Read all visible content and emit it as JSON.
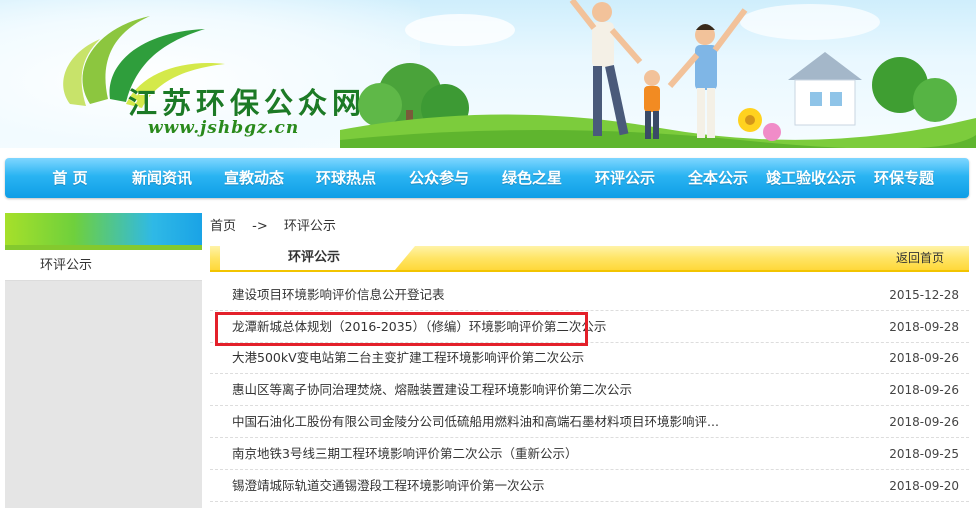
{
  "header": {
    "site_name": "江苏环保公众网",
    "site_url": "www.jshbgz.cn"
  },
  "nav": {
    "items": [
      "首 页",
      "新闻资讯",
      "宣教动态",
      "环球热点",
      "公众参与",
      "绿色之星",
      "环评公示",
      "全本公示",
      "竣工验收公示",
      "环保专题"
    ]
  },
  "sidebar": {
    "items": [
      "环评公示"
    ]
  },
  "breadcrumb": {
    "home": "首页",
    "separator": "->",
    "current": "环评公示"
  },
  "section": {
    "title": "环评公示",
    "back_label": "返回首页"
  },
  "articles": [
    {
      "title": "建设项目环境影响评价信息公开登记表",
      "date": "2015-12-28"
    },
    {
      "title": "龙潭新城总体规划（2016-2035）（修编）环境影响评价第二次公示",
      "date": "2018-09-28"
    },
    {
      "title": "大港500kV变电站第二台主变扩建工程环境影响评价第二次公示",
      "date": "2018-09-26"
    },
    {
      "title": "惠山区等离子协同治理焚烧、熔融装置建设工程环境影响评价第二次公示",
      "date": "2018-09-26"
    },
    {
      "title": "中国石油化工股份有限公司金陵分公司低硫船用燃料油和高端石墨材料项目环境影响评...",
      "date": "2018-09-26"
    },
    {
      "title": "南京地铁3号线三期工程环境影响评价第二次公示（重新公示）",
      "date": "2018-09-25"
    },
    {
      "title": "锡澄靖城际轨道交通锡澄段工程环境影响评价第一次公示",
      "date": "2018-09-20"
    }
  ],
  "colors": {
    "nav_blue": "#1aa8ec",
    "title_yellow": "#ffe566",
    "highlight_red": "#e3202a",
    "brand_green": "#1c7a26"
  }
}
